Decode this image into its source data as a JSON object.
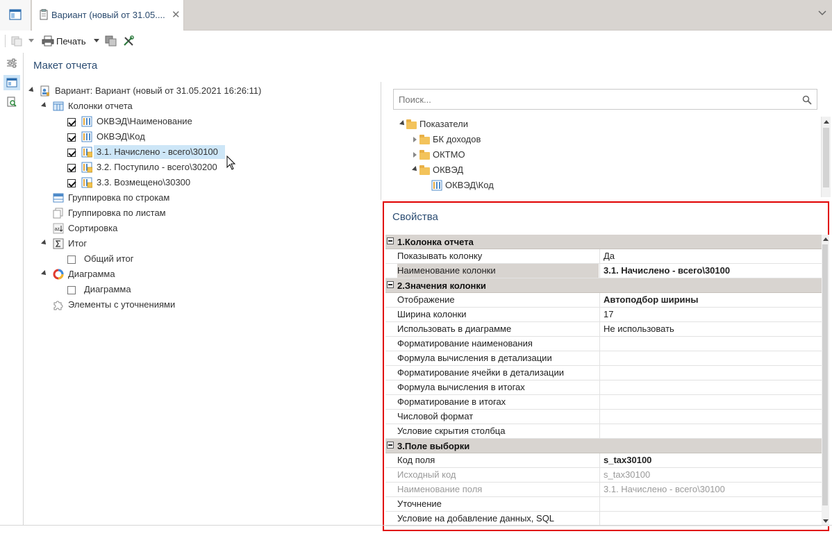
{
  "tabs": {
    "doc_tab_title": "Вариант (новый от 31.05....",
    "close_glyph": "✕"
  },
  "toolbar": {
    "print_label": "Печать"
  },
  "panel": {
    "title": "Макет отчета"
  },
  "tree": {
    "root": "Вариант: Вариант (новый от 31.05.2021 16:26:11)",
    "columns_group": "Колонки отчета",
    "columns": [
      {
        "label": "ОКВЭД\\Наименование",
        "checked": true,
        "selected": false
      },
      {
        "label": "ОКВЭД\\Код",
        "checked": true,
        "selected": false
      },
      {
        "label": "3.1. Начислено - всего\\30100",
        "checked": true,
        "selected": true
      },
      {
        "label": "3.2. Поступило - всего\\30200",
        "checked": true,
        "selected": false
      },
      {
        "label": "3.3. Возмещено\\30300",
        "checked": true,
        "selected": false
      }
    ],
    "group_rows": "Группировка по строкам",
    "group_sheets": "Группировка по листам",
    "sorting": "Сортировка",
    "total_group": "Итог",
    "total_item": "Общий итог",
    "chart_group": "Диаграмма",
    "chart_item": "Диаграмма",
    "refine": "Элементы с уточнениями"
  },
  "search": {
    "placeholder": "Поиск..."
  },
  "indicators": {
    "root": "Показатели",
    "items": [
      "БК доходов",
      "ОКТМО",
      "ОКВЭД"
    ],
    "sub_item": "ОКВЭД\\Код"
  },
  "properties": {
    "title": "Свойства",
    "cat1": "1.Колонка отчета",
    "cat2": "2.Значения колонки",
    "cat3": "3.Поле выборки",
    "rows1": [
      {
        "name": "Показывать колонку",
        "value": "Да"
      },
      {
        "name": "Наименование колонки",
        "value": "3.1. Начислено - всего\\30100"
      }
    ],
    "rows2": [
      {
        "name": "Отображение",
        "value": "Автоподбор ширины"
      },
      {
        "name": "Ширина колонки",
        "value": "17"
      },
      {
        "name": "Использовать в диаграмме",
        "value": "Не использовать"
      },
      {
        "name": "Форматирование наименования",
        "value": ""
      },
      {
        "name": "Формула вычисления в детализации",
        "value": ""
      },
      {
        "name": "Форматирование ячейки в детализации",
        "value": ""
      },
      {
        "name": "Формула вычисления в итогах",
        "value": ""
      },
      {
        "name": "Форматирование в итогах",
        "value": ""
      },
      {
        "name": "Числовой формат",
        "value": ""
      },
      {
        "name": "Условие скрытия столбца",
        "value": ""
      }
    ],
    "rows3": [
      {
        "name": "Код поля",
        "value": "s_tax30100"
      },
      {
        "name": "Исходный код",
        "value": "s_tax30100"
      },
      {
        "name": "Наименование поля",
        "value": "3.1. Начислено - всего\\30100"
      },
      {
        "name": "Уточнение",
        "value": ""
      },
      {
        "name": "Условие на добавление данных, SQL",
        "value": ""
      }
    ]
  },
  "colors": {
    "accent_title": "#2b4c72",
    "selection": "#cde6f7",
    "highlight_frame": "#e00000",
    "category_bg": "#d8d4d0"
  }
}
